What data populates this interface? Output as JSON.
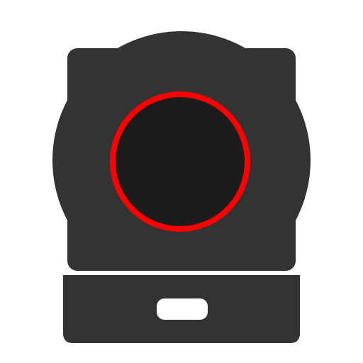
{
  "icon": {
    "name": "induction-cooktop-icon",
    "colors": {
      "background": "#ffffff",
      "body": "#333333",
      "burner": "#1c1c1c",
      "burner_ring": "#ff0000",
      "separator": "#ffffff",
      "handle": "#ffffff"
    }
  }
}
